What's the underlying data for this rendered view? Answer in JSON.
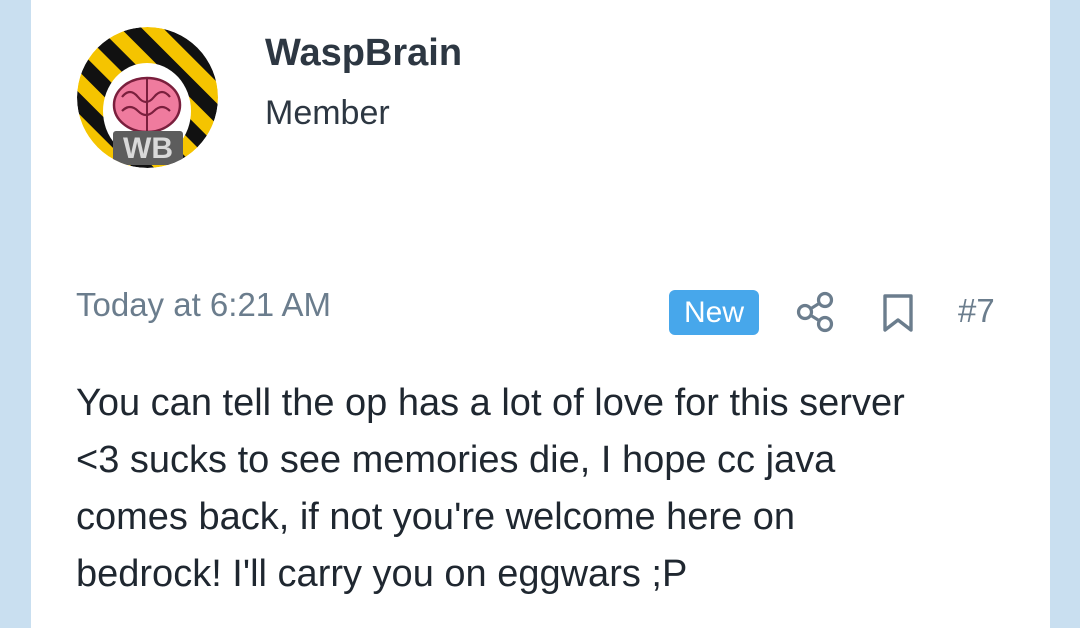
{
  "user": {
    "name": "WaspBrain",
    "role": "Member",
    "avatar_icon": "brain-hazard-stripes-avatar"
  },
  "post": {
    "timestamp": "Today at 6:21 AM",
    "badge": "New",
    "share_icon": "share-icon",
    "bookmark_icon": "bookmark-icon",
    "number": "#7",
    "lines": [
      "You can tell the op has a lot of love for this server",
      "<3 sucks to see memories die, I hope cc java",
      "comes back, if not you're welcome here on",
      "bedrock! I'll carry you on eggwars ;P"
    ]
  },
  "colors": {
    "page_background": "#c9dff0",
    "card_background": "#ffffff",
    "badge": "#47a7eb",
    "muted_text": "#6b7d8d",
    "text": "#1f2730"
  }
}
